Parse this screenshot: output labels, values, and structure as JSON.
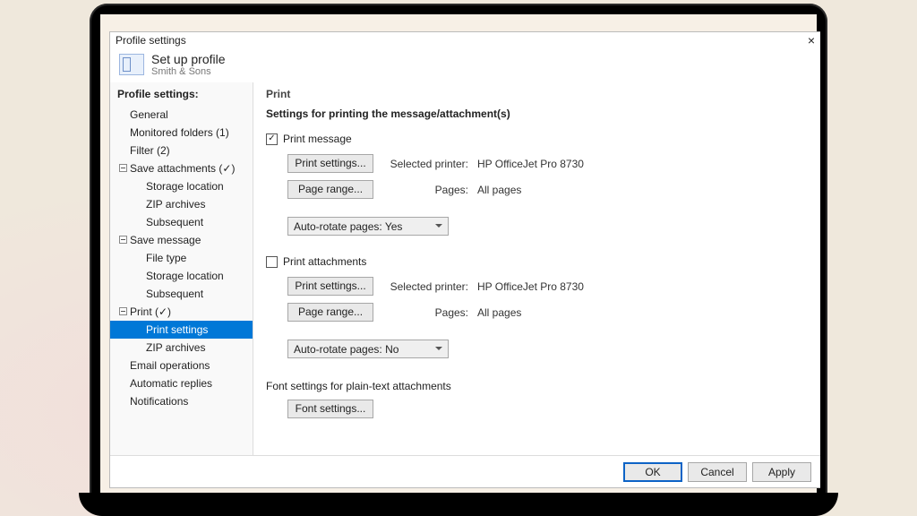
{
  "window_title": "Profile settings",
  "header": {
    "title": "Set up profile",
    "subtitle": "Smith & Sons"
  },
  "sidebar": {
    "title": "Profile settings:",
    "general": "General",
    "monitored": "Monitored folders (1)",
    "filter": "Filter (2)",
    "save_att": "Save attachments (✓)",
    "storage": "Storage location",
    "zip": "ZIP archives",
    "subsequent": "Subsequent",
    "save_msg": "Save message",
    "file_type": "File type",
    "print": "Print  (✓)",
    "print_settings": "Print settings",
    "email_ops": "Email operations",
    "auto_replies": "Automatic replies",
    "notifications": "Notifications"
  },
  "main": {
    "title": "Print",
    "desc": "Settings for printing the message/attachment(s)",
    "chk_msg": "Print message",
    "chk_att": "Print attachments",
    "btn_print_settings": "Print settings...",
    "btn_page_range": "Page range...",
    "lbl_sel_printer": "Selected printer:",
    "lbl_pages": "Pages:",
    "val_printer": "HP OfficeJet Pro 8730",
    "val_pages": "All pages",
    "sel_rotate_yes": "Auto-rotate pages: Yes",
    "sel_rotate_no": "Auto-rotate pages: No",
    "font_section": "Font settings for plain-text attachments",
    "btn_font": "Font settings..."
  },
  "footer": {
    "ok": "OK",
    "cancel": "Cancel",
    "apply": "Apply"
  }
}
